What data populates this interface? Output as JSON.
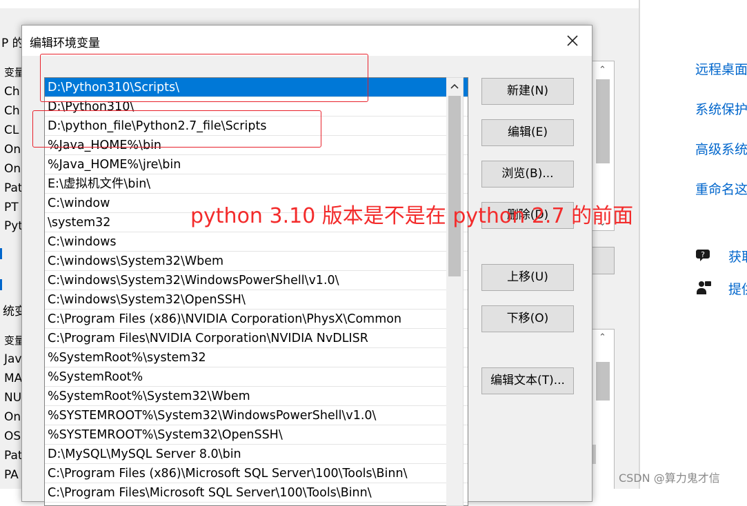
{
  "background_window": {
    "left_fragments": [
      "P 的",
      "变量",
      "Ch",
      "Ch",
      "CL",
      "On",
      "On",
      "Pat",
      "PT",
      "Pyt",
      "统变",
      "变量",
      "Jav",
      "MA",
      "NU",
      "On",
      "OS",
      "Pat",
      "PA"
    ]
  },
  "right_panel": {
    "links": [
      "远程桌面",
      "系统保护",
      "高级系统",
      "重命名这"
    ],
    "actions": [
      {
        "icon": "help-chat-icon",
        "label": "获取"
      },
      {
        "icon": "feedback-person-icon",
        "label": "提供"
      }
    ]
  },
  "dialog": {
    "title": "编辑环境变量",
    "close_icon": "close-icon",
    "entries": [
      "D:\\Python310\\Scripts\\",
      "D:\\Python310\\",
      "D:\\python_file\\Python2.7_file\\Scripts",
      "%Java_HOME%\\bin",
      "%Java_HOME%\\jre\\bin",
      "E:\\虚拟机文件\\bin\\",
      "C:\\window",
      "\\system32",
      "C:\\windows",
      "C:\\windows\\System32\\Wbem",
      "C:\\windows\\System32\\WindowsPowerShell\\v1.0\\",
      "C:\\windows\\System32\\OpenSSH\\",
      "C:\\Program Files (x86)\\NVIDIA Corporation\\PhysX\\Common",
      "C:\\Program Files\\NVIDIA Corporation\\NVIDIA NvDLISR",
      "%SystemRoot%\\system32",
      "%SystemRoot%",
      "%SystemRoot%\\System32\\Wbem",
      "%SYSTEMROOT%\\System32\\WindowsPowerShell\\v1.0\\",
      "%SYSTEMROOT%\\System32\\OpenSSH\\",
      "D:\\MySQL\\MySQL Server 8.0\\bin",
      "C:\\Program Files (x86)\\Microsoft SQL Server\\100\\Tools\\Binn\\",
      "C:\\Program Files\\Microsoft SQL Server\\100\\Tools\\Binn\\"
    ],
    "selected_index": 0,
    "buttons": {
      "new": "新建(N)",
      "edit": "编辑(E)",
      "browse": "浏览(B)...",
      "delete": "删除(D)",
      "move_up": "上移(U)",
      "move_down": "下移(O)",
      "edit_text": "编辑文本(T)..."
    }
  },
  "annotation": {
    "note": "python 3.10 版本是不是在 python 2.7 的前面",
    "color": "#f32b2b"
  },
  "watermark": "CSDN @算力鬼才信",
  "colors": {
    "selection": "#0078d7",
    "link": "#0066cc",
    "annotation_box": "#e8202a"
  }
}
